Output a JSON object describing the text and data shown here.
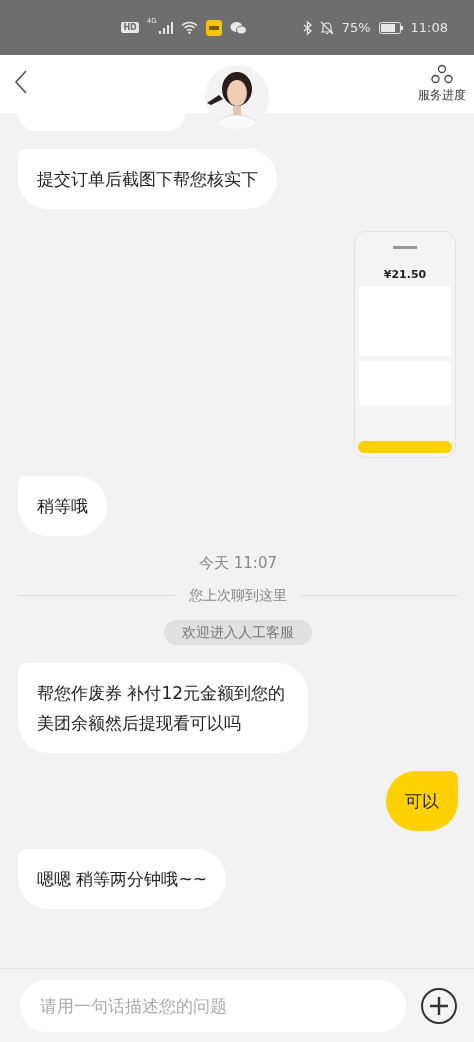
{
  "status_bar": {
    "hd": "HD",
    "network": "4G",
    "battery": "75%",
    "time": "11:08"
  },
  "header": {
    "progress_label": "服务进度"
  },
  "messages": [
    {
      "kind": "incoming",
      "text": "提交订单后截图下帮您核实下"
    },
    {
      "screenshot": {
        "amount": "¥21.50"
      }
    },
    {
      "kind": "incoming",
      "text": "稍等哦"
    },
    {
      "kind": "time",
      "text": "今天 11:07"
    },
    {
      "kind": "divider",
      "text": "您上次聊到这里"
    },
    {
      "kind": "notice",
      "text": "欢迎进入人工客服"
    },
    {
      "kind": "incoming",
      "text": "帮您作废券 补付12元金额到您的美团余额然后提现看可以吗"
    },
    {
      "kind": "outgoing",
      "text": "可以"
    },
    {
      "kind": "incoming",
      "text": "嗯嗯 稍等两分钟哦~~"
    }
  ],
  "input": {
    "placeholder": "请用一句话描述您的问题"
  }
}
